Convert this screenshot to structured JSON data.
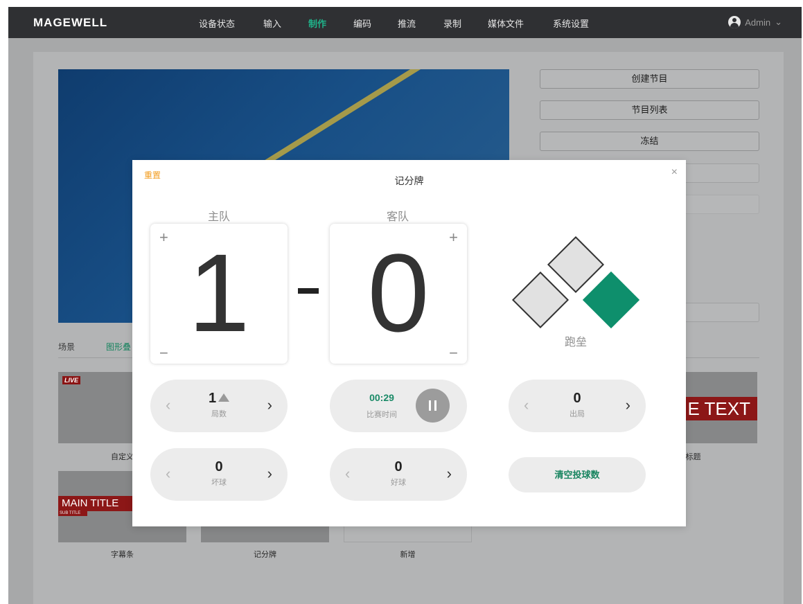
{
  "nav": {
    "logo": "MAGEWELL",
    "items": [
      "设备状态",
      "输入",
      "制作",
      "编码",
      "推流",
      "录制",
      "媒体文件",
      "系统设置"
    ],
    "active": "制作",
    "user": "Admin"
  },
  "side_buttons": [
    "创建节目",
    "节目列表",
    "冻结"
  ],
  "tabs": [
    "场景",
    "图形叠"
  ],
  "thumbnails": {
    "live_badge": "LIVE",
    "captions": [
      "自定义",
      "标题",
      "字幕条",
      "记分牌",
      "新增"
    ],
    "lower_third_title": "MAIN TITLE",
    "lower_third_sub": "SUB TITLE",
    "title_strip_text": "E TEXT"
  },
  "scoreboard": {
    "reset_label": "重置",
    "title": "记分牌",
    "close_symbol": "×",
    "home": {
      "label": "主队",
      "score": "1"
    },
    "away": {
      "label": "客队",
      "score": "0"
    },
    "plus_symbol": "+",
    "minus_symbol": "−",
    "bases_label": "跑垒",
    "bases_occupied": {
      "first": true,
      "second": false,
      "third": false
    },
    "inning": {
      "value": "1",
      "label": "局数",
      "half": "top"
    },
    "timer": {
      "value": "00:29",
      "label": "比赛时间"
    },
    "outs": {
      "value": "0",
      "label": "出局"
    },
    "balls": {
      "value": "0",
      "label": "坏球"
    },
    "strikes": {
      "value": "0",
      "label": "好球"
    },
    "clear_label": "清空投球数",
    "prev_arrow": "‹",
    "next_arrow": "›"
  },
  "colors": {
    "accent": "#0e8f6c",
    "reset": "#f29b1c",
    "topbar": "#2f3033"
  }
}
